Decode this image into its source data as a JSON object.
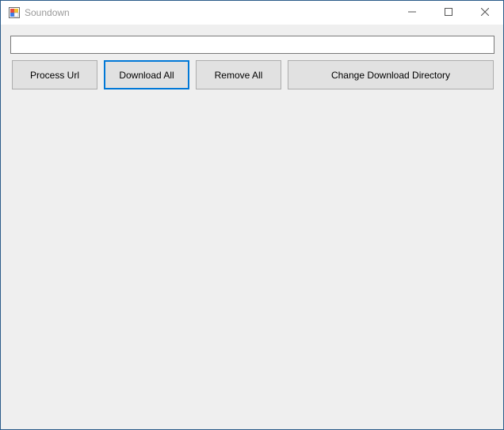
{
  "window": {
    "title": "Soundown",
    "icon": "app-window-icon",
    "controls": {
      "minimize_icon": "minimize-icon",
      "maximize_icon": "maximize-icon",
      "close_icon": "close-icon"
    }
  },
  "url_field": {
    "value": "",
    "placeholder": ""
  },
  "buttons": {
    "process_url": "Process Url",
    "download_all": "Download All",
    "remove_all": "Remove All",
    "change_dir": "Change Download Directory"
  },
  "colors": {
    "focus_border": "#0078d7",
    "window_border": "#2b5c8a",
    "client_bg": "#efefef"
  }
}
